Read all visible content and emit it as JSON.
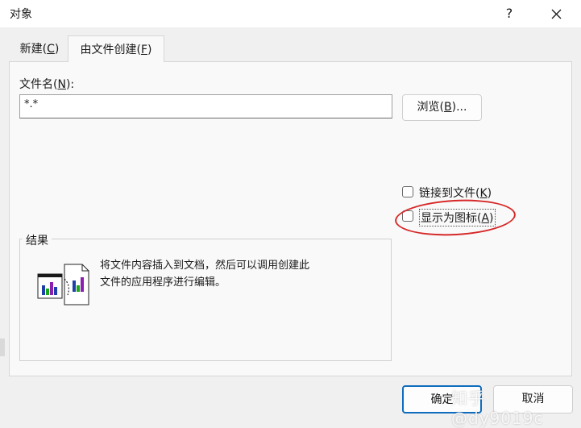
{
  "window": {
    "title": "对象",
    "help_label": "?"
  },
  "tabs": [
    {
      "label": "新建(",
      "key": "C",
      "suffix": ")"
    },
    {
      "label": "由文件创建(",
      "key": "F",
      "suffix": ")"
    }
  ],
  "file_name": {
    "label": "文件名(",
    "key": "N",
    "suffix": "):",
    "value": "*.*"
  },
  "browse": {
    "label": "浏览(",
    "key": "B",
    "suffix": ")..."
  },
  "options": {
    "link": {
      "label": "链接到文件(",
      "key": "K",
      "suffix": ")",
      "checked": false
    },
    "as_icon": {
      "label": "显示为图标(",
      "key": "A",
      "suffix": ")",
      "checked": false
    }
  },
  "result": {
    "heading": "结果",
    "line1": "将文件内容插入到文档，然后可以调用创建此",
    "line2": "文件的应用程序进行编辑。"
  },
  "buttons": {
    "ok": "确定",
    "cancel": "取消"
  },
  "watermark": "知乎 @dy9019c",
  "colors": {
    "highlight": "#d62828",
    "default_button_border": "#0f6cbd"
  }
}
